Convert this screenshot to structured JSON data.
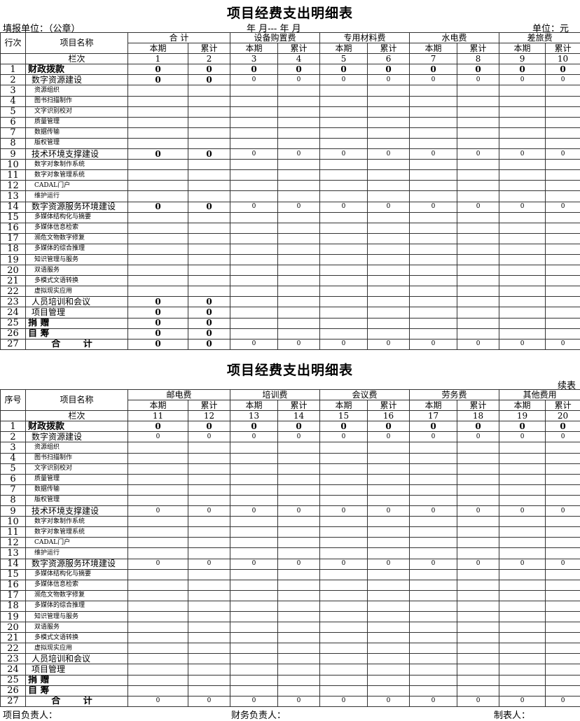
{
  "title1": "项目经费支出明细表",
  "title2": "项目经费支出明细表",
  "header": {
    "unit_label": "填报单位：（公章）",
    "period": "年   月---  年   月",
    "currency": "单位：元",
    "continued": "续表"
  },
  "table1": {
    "row_label": "行次",
    "name_label": "项目名称",
    "col_label": "栏次",
    "groups": [
      "合 计",
      "设备购置费",
      "专用材料费",
      "水电费",
      "差旅费"
    ],
    "sub": [
      "本期",
      "累计"
    ],
    "col_nums": [
      "1",
      "2",
      "3",
      "4",
      "5",
      "6",
      "7",
      "8",
      "9",
      "10"
    ]
  },
  "table2": {
    "row_label": "序号",
    "name_label": "项目名称",
    "col_label": "栏次",
    "groups": [
      "邮电费",
      "培训费",
      "会议费",
      "劳务费",
      "其他费用"
    ],
    "sub": [
      "本期",
      "累计"
    ],
    "col_nums": [
      "11",
      "12",
      "13",
      "14",
      "15",
      "16",
      "17",
      "18",
      "19",
      "20"
    ]
  },
  "rows": [
    {
      "n": "1",
      "name": "财政拨款",
      "lvl": 0
    },
    {
      "n": "2",
      "name": "数字资源建设",
      "lvl": 1
    },
    {
      "n": "3",
      "name": "资源组织",
      "lvl": 2
    },
    {
      "n": "4",
      "name": "图书扫描制作",
      "lvl": 2
    },
    {
      "n": "5",
      "name": "文字识别校对",
      "lvl": 2
    },
    {
      "n": "6",
      "name": "质量管理",
      "lvl": 2
    },
    {
      "n": "7",
      "name": "数据传输",
      "lvl": 2
    },
    {
      "n": "8",
      "name": "版权管理",
      "lvl": 2
    },
    {
      "n": "9",
      "name": "技术环境支撑建设",
      "lvl": 1
    },
    {
      "n": "10",
      "name": "数字对象制作系统",
      "lvl": 2
    },
    {
      "n": "11",
      "name": "数字对象管理系统",
      "lvl": 2
    },
    {
      "n": "12",
      "name": "CADAL门户",
      "lvl": 2
    },
    {
      "n": "13",
      "name": "维护运行",
      "lvl": 2
    },
    {
      "n": "14",
      "name": "数字资源服务环境建设",
      "lvl": 1
    },
    {
      "n": "15",
      "name": "多媒体结构化与摘要",
      "lvl": 2
    },
    {
      "n": "16",
      "name": "多媒体信息检索",
      "lvl": 2
    },
    {
      "n": "17",
      "name": "濒危文物数字修复",
      "lvl": 2
    },
    {
      "n": "18",
      "name": "多媒体的综合推理",
      "lvl": 2
    },
    {
      "n": "19",
      "name": "知识管理与服务",
      "lvl": 2
    },
    {
      "n": "20",
      "name": "双语服务",
      "lvl": 2
    },
    {
      "n": "21",
      "name": "多模式文语转换",
      "lvl": 2
    },
    {
      "n": "22",
      "name": "虚拟现实应用",
      "lvl": 2
    },
    {
      "n": "23",
      "name": "人员培训和会议",
      "lvl": 1
    },
    {
      "n": "24",
      "name": "项目管理",
      "lvl": 1
    },
    {
      "n": "25",
      "name": "捐  赠",
      "lvl": 0
    },
    {
      "n": "26",
      "name": "自  筹",
      "lvl": 0
    },
    {
      "n": "27",
      "name": "合  计",
      "lvl": "tot"
    }
  ],
  "values1": {
    "1": [
      "b",
      "0",
      "0",
      "0",
      "0",
      "0",
      "0",
      "0",
      "0",
      "0",
      "0"
    ],
    "2": [
      "b",
      "0",
      "0",
      "s0",
      "s0",
      "s0",
      "s0",
      "s0",
      "s0",
      "s0",
      "s0"
    ],
    "9": [
      "b",
      "0",
      "0",
      "s0",
      "s0",
      "s0",
      "s0",
      "s0",
      "s0",
      "s0",
      "s0"
    ],
    "14": [
      "b",
      "0",
      "0",
      "s0",
      "s0",
      "s0",
      "s0",
      "s0",
      "s0",
      "s0",
      "s0"
    ],
    "23": [
      "b",
      "0",
      "0",
      "",
      "",
      "",
      "",
      "",
      "",
      "",
      ""
    ],
    "24": [
      "b",
      "0",
      "0",
      "",
      "",
      "",
      "",
      "",
      "",
      "",
      ""
    ],
    "25": [
      "b",
      "0",
      "0",
      "",
      "",
      "",
      "",
      "",
      "",
      "",
      ""
    ],
    "26": [
      "b",
      "0",
      "0",
      "",
      "",
      "",
      "",
      "",
      "",
      "",
      ""
    ],
    "27": [
      "b",
      "0",
      "0",
      "s0",
      "s0",
      "s0",
      "s0",
      "s0",
      "s0",
      "s0",
      "s0"
    ]
  },
  "values2": {
    "1": [
      "b",
      "0",
      "0",
      "0",
      "0",
      "0",
      "0",
      "0",
      "0",
      "0",
      "0"
    ],
    "2": [
      "b",
      "s0",
      "s0",
      "s0",
      "s0",
      "s0",
      "s0",
      "s0",
      "s0",
      "s0",
      "s0"
    ],
    "9": [
      "b",
      "s0",
      "s0",
      "s0",
      "s0",
      "s0",
      "s0",
      "s0",
      "s0",
      "s0",
      "s0"
    ],
    "14": [
      "b",
      "s0",
      "s0",
      "s0",
      "s0",
      "s0",
      "s0",
      "s0",
      "s0",
      "s0",
      "s0"
    ],
    "27": [
      "b",
      "s0",
      "s0",
      "s0",
      "s0",
      "s0",
      "s0",
      "s0",
      "s0",
      "s0",
      "s0"
    ]
  },
  "footer": {
    "project_lead": "项目负责人：",
    "finance_lead": "财务负责人：",
    "preparer": "制表人："
  }
}
